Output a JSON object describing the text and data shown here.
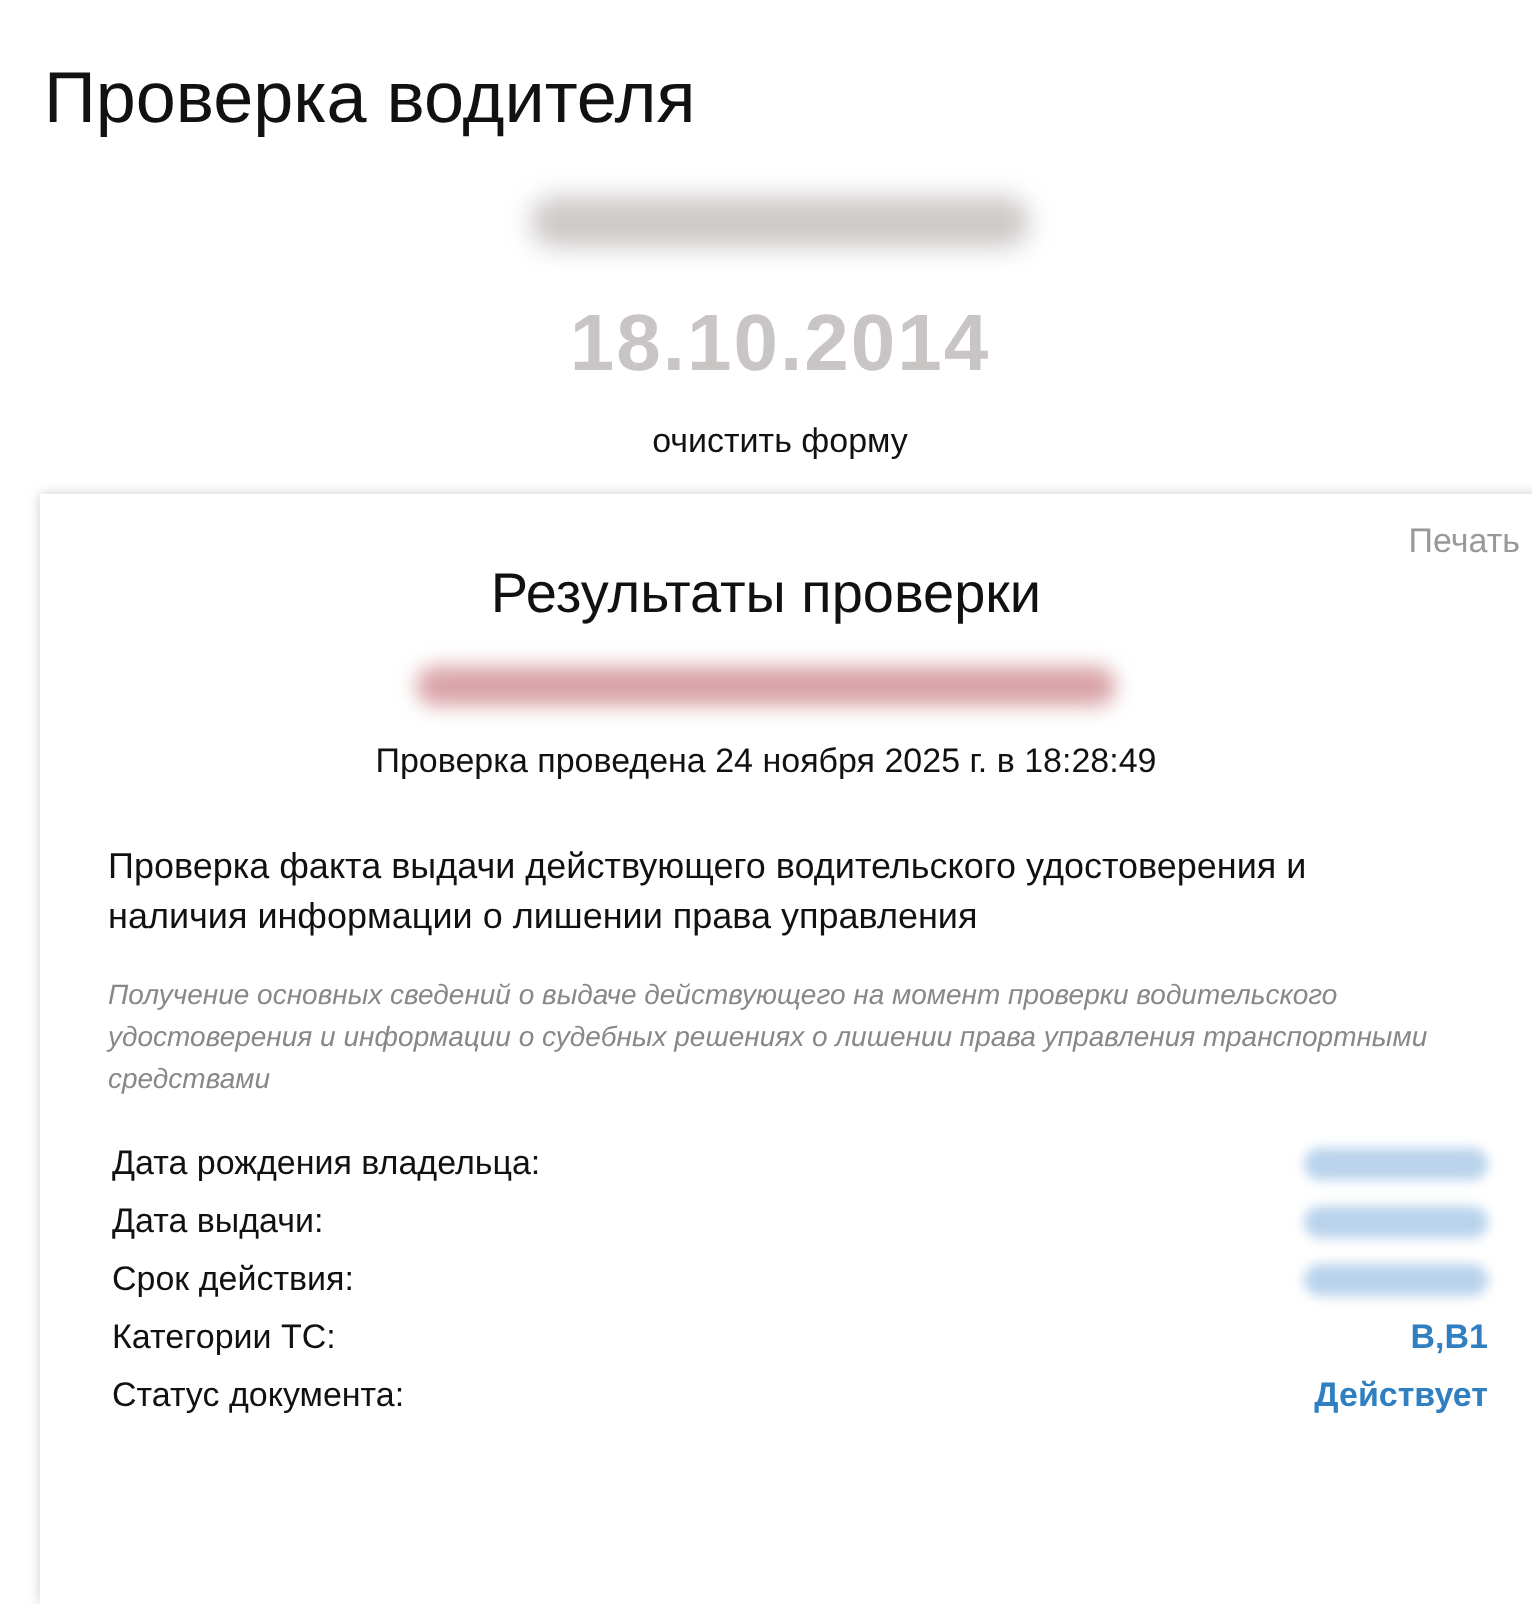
{
  "page_title": "Проверка водителя",
  "form": {
    "date": "18.10.2014",
    "clear_link": "очистить форму"
  },
  "results": {
    "print_link": "Печать",
    "title": "Результаты проверки",
    "checked_at": "Проверка проведена 24 ноября 2025 г. в 18:28:49",
    "section_title": "Проверка факта выдачи действующего водительского удостоверения и наличия информации о лишении права управления",
    "section_note": "Получение основных сведений о выдаче действующего на момент проверки водительского удостоверения и информации о судебных решениях о лишении права управления транспортными средствами",
    "fields": [
      {
        "label": "Дата рождения владельца:",
        "kind": "redacted"
      },
      {
        "label": "Дата выдачи:",
        "kind": "redacted"
      },
      {
        "label": "Срок действия:",
        "kind": "redacted"
      },
      {
        "label": "Категории ТС:",
        "kind": "text",
        "value": "B,B1"
      },
      {
        "label": "Статус документа:",
        "kind": "text",
        "value": "Действует"
      }
    ]
  }
}
